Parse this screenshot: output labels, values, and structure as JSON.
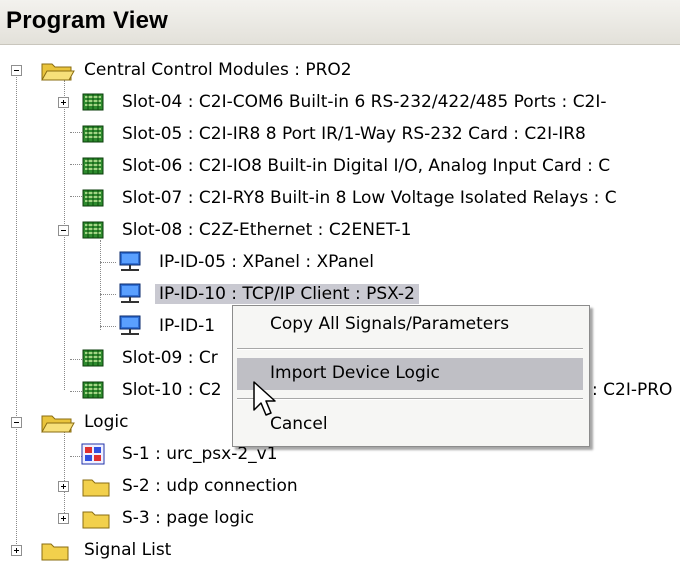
{
  "panel": {
    "title": "Program View"
  },
  "tree": {
    "root_ccm": "Central Control Modules : PRO2",
    "slot04": "Slot-04 : C2I-COM6 Built-in 6 RS-232/422/485 Ports : C2I-",
    "slot05": "Slot-05 : C2I-IR8 8 Port IR/1-Way RS-232 Card : C2I-IR8",
    "slot06": "Slot-06 : C2I-IO8 Built-in Digital I/O, Analog Input Card : C",
    "slot07": "Slot-07 : C2I-RY8 Built-in 8 Low Voltage Isolated Relays : C",
    "slot08": "Slot-08 : C2Z-Ethernet : C2ENET-1",
    "ip05": "IP-ID-05 : XPanel : XPanel",
    "ip10": "IP-ID-10 : TCP/IP Client : PSX-2",
    "ip1x": "IP-ID-1",
    "slot09": "Slot-09 : Cr",
    "slot10": "Slot-10 : C2",
    "slot10_tail": ": C2I-PRO",
    "logic": "Logic",
    "s1": "S-1 : urc_psx-2_v1",
    "s2": "S-2 : udp connection",
    "s3": "S-3 : page logic",
    "signal_list": "Signal List"
  },
  "context_menu": {
    "copy": "Copy All Signals/Parameters",
    "import": "Import Device Logic",
    "cancel": "Cancel"
  },
  "colors": {
    "selection": "#c9c9d1",
    "menu_highlight": "#bfbfc5",
    "folder": "#f2d04c",
    "card": "#2e8b2e"
  }
}
